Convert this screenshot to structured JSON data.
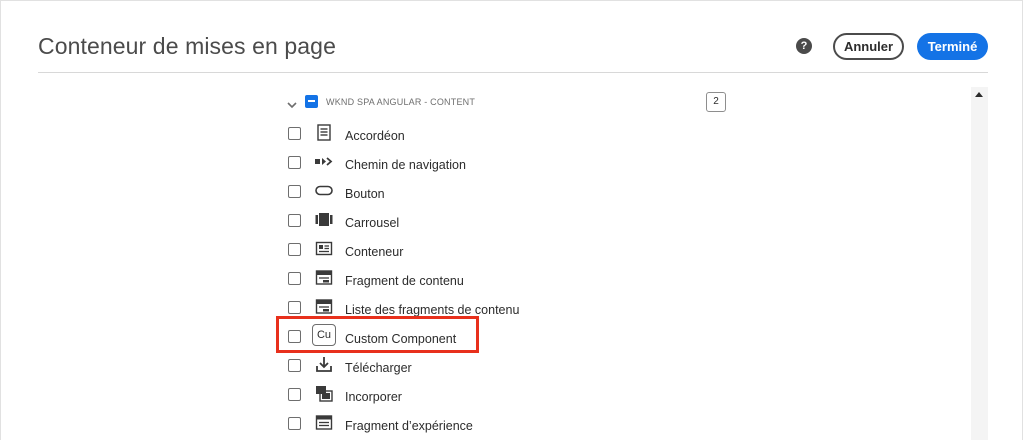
{
  "dialog": {
    "title": "Conteneur de mises en page",
    "cancel_label": "Annuler",
    "done_label": "Terminé",
    "help_glyph": "?"
  },
  "group": {
    "label": "WKND SPA ANGULAR - CONTENT",
    "count": "2",
    "expanded": true,
    "checked_state": "indeterminate"
  },
  "items": [
    {
      "label": "Accordéon",
      "icon": "accordion-icon"
    },
    {
      "label": "Chemin de navigation",
      "icon": "breadcrumb-icon"
    },
    {
      "label": "Bouton",
      "icon": "button-icon"
    },
    {
      "label": "Carrousel",
      "icon": "carousel-icon"
    },
    {
      "label": "Conteneur",
      "icon": "container-icon"
    },
    {
      "label": "Fragment de contenu",
      "icon": "content-fragment-icon"
    },
    {
      "label": "Liste des fragments de contenu",
      "icon": "content-fragment-list-icon"
    },
    {
      "label": "Custom Component",
      "icon": "custom-component-badge",
      "badge": "Cu",
      "highlighted": true
    },
    {
      "label": "Télécharger",
      "icon": "download-icon"
    },
    {
      "label": "Incorporer",
      "icon": "embed-icon"
    },
    {
      "label": "Fragment d’expérience",
      "icon": "experience-fragment-icon"
    }
  ],
  "colors": {
    "accent": "#1473e6",
    "highlight": "#e8301c"
  }
}
